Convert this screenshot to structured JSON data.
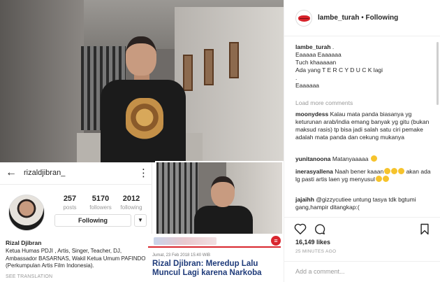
{
  "header": {
    "username": "lambe_turah",
    "separator": " • ",
    "follow_status": "Following"
  },
  "caption": {
    "username": "lambe_turah",
    "suffix": " .",
    "lines": [
      "Eaaaaa Eaaaaaa",
      "Tuch khaaaaan",
      "Ada yang T E R C Y D U C K lagi",
      ".",
      "Eaaaaaa"
    ]
  },
  "load_more": "Load more comments",
  "comments": [
    {
      "user": "moonydess",
      "text": "Kalau mata panda biasanya yg keturunan arab/india emang banyak yg gitu (bukan maksud rasis) tp bisa jadi salah satu ciri pemake adalah mata panda dan cekung mukanya"
    },
    {
      "user": "yunitanoona",
      "text": "Matanyaaaaa"
    },
    {
      "user": "inerasyallena",
      "text": "Naah bener kaaan",
      "text2": " akan ada lg pasti artis laen yg menyusul"
    },
    {
      "user": "jajaihh",
      "text": "@gizzycutiee untung tasya tdk bgtumi gang,hampir ditangkap:("
    }
  ],
  "likes": "16,149 likes",
  "time_ago": "25 MINUTES AGO",
  "add_comment_placeholder": "Add a comment...",
  "profile": {
    "username": "rizaldjibran_",
    "stats": [
      {
        "num": "257",
        "label": "posts"
      },
      {
        "num": "5170",
        "label": "followers"
      },
      {
        "num": "2012",
        "label": "following"
      }
    ],
    "follow_button": "Following",
    "name": "Rizal Djibran",
    "bio": "Ketua Humas PDJI , Artis, Singer, Teacher, DJ, Ambassador BASARNAS, Wakil Ketua Umum PAFINDO (Perkumpulan Artis Film Indonesia).",
    "translate": "SEE TRANSLATION"
  },
  "news": {
    "date": "Jumat, 23 Feb 2018 15:40 WIB",
    "title": "Rizal Djibran: Meredup Lalu Muncul Lagi karena Narkoba"
  },
  "colors": {
    "accent_red": "#d9262e",
    "news_title": "#1f3b7a",
    "muted": "#999999"
  }
}
